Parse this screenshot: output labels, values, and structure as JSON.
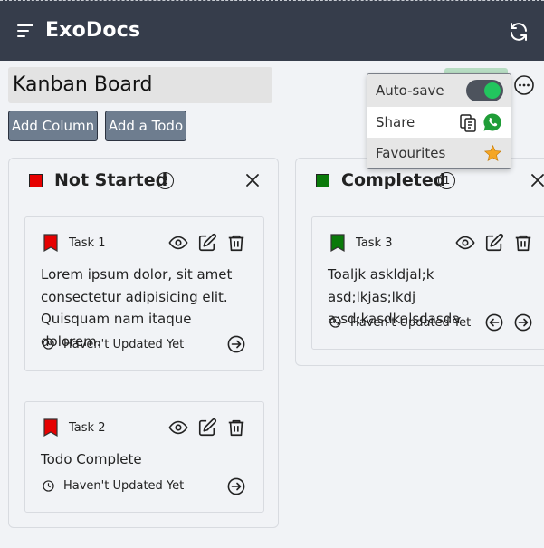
{
  "header": {
    "brand": "ExoDocs",
    "menu_icon": "hamburger-menu-icon",
    "refresh_icon": "refresh-icon"
  },
  "board": {
    "title": "Kanban Board",
    "add_column_label": "Add Column",
    "add_todo_label": "Add a Todo"
  },
  "options_menu": {
    "autosave_label": "Auto-save",
    "autosave_enabled": true,
    "share_label": "Share",
    "favourites_label": "Favourites",
    "more_icon": "more-horizontal-icon"
  },
  "columns": [
    {
      "title": "Not Started",
      "count": "2",
      "color": "#e60000",
      "tasks": [
        {
          "name": "Task 1",
          "description": "Lorem ipsum dolor, sit amet consectetur adipisicing elit. Quisquam nam itaque dolorem.",
          "updated": "Haven't Updated Yet"
        },
        {
          "name": "Task 2",
          "description": "Todo Complete",
          "updated": "Haven't Updated Yet"
        }
      ]
    },
    {
      "title": "Completed",
      "count": "1",
      "color": "#0a7a0a",
      "tasks": [
        {
          "name": "Task 3",
          "description": "Toaljk askldjal;k asd;lkjas;lkdj a;sd;kasdkalsdasda",
          "updated": "Haven't Updated Yet"
        }
      ]
    }
  ],
  "colors": {
    "topbar": "#363d4b",
    "toggle_on": "#22c55e",
    "star": "#f5a623",
    "whatsapp": "#1f9d37"
  }
}
